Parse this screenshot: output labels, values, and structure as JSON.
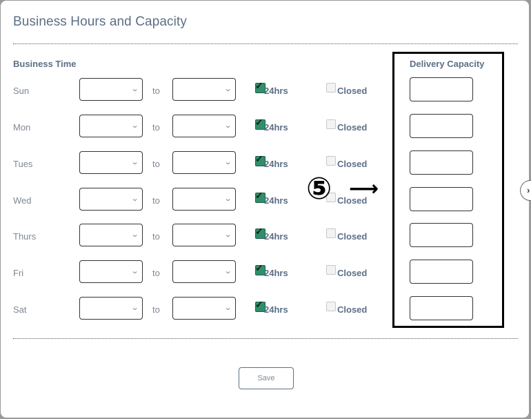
{
  "modal": {
    "title": "Business Hours and Capacity",
    "business_time_label": "Business Time",
    "delivery_capacity_label": "Delivery Capacity",
    "to_label": "to",
    "hours24_label": "24hrs",
    "closed_label": "Closed",
    "save_label": "Save"
  },
  "days": [
    {
      "name": "Sun",
      "from": "",
      "to": "",
      "hours24": true,
      "closed": false,
      "capacity": ""
    },
    {
      "name": "Mon",
      "from": "",
      "to": "",
      "hours24": true,
      "closed": false,
      "capacity": ""
    },
    {
      "name": "Tues",
      "from": "",
      "to": "",
      "hours24": true,
      "closed": false,
      "capacity": ""
    },
    {
      "name": "Wed",
      "from": "",
      "to": "",
      "hours24": true,
      "closed": false,
      "capacity": ""
    },
    {
      "name": "Thurs",
      "from": "",
      "to": "",
      "hours24": true,
      "closed": false,
      "capacity": ""
    },
    {
      "name": "Fri",
      "from": "",
      "to": "",
      "hours24": true,
      "closed": false,
      "capacity": ""
    },
    {
      "name": "Sat",
      "from": "",
      "to": "",
      "hours24": true,
      "closed": false,
      "capacity": ""
    }
  ],
  "annotation": {
    "step_marker": "⑤",
    "arrow": "⟶"
  },
  "colors": {
    "accent_text": "#5c6f86",
    "checkbox_checked": "#2f8f6a",
    "highlight_border": "#000000"
  },
  "icons": {
    "dropdown": "chevron-down-icon",
    "next": "chevron-right-icon"
  }
}
